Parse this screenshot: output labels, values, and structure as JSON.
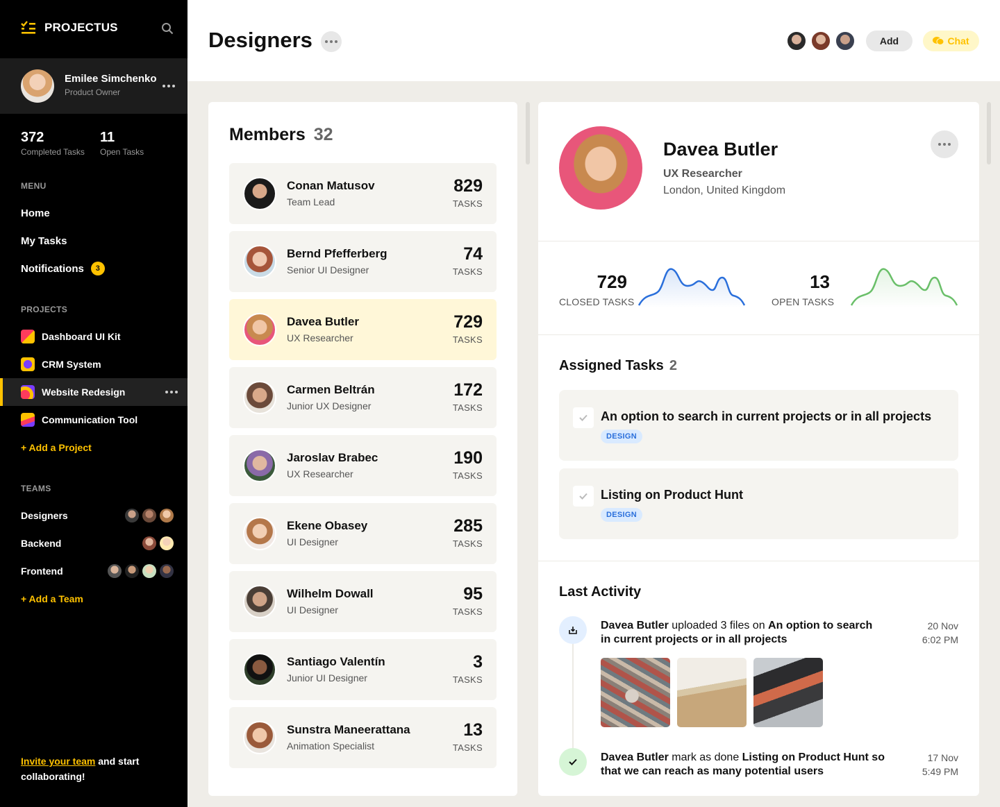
{
  "app": {
    "name": "PROJECTUS"
  },
  "user": {
    "name": "Emilee Simchenko",
    "role": "Product Owner"
  },
  "stats": [
    {
      "value": "372",
      "label": "Completed Tasks"
    },
    {
      "value": "11",
      "label": "Open Tasks"
    }
  ],
  "menu": {
    "heading": "MENU",
    "items": [
      {
        "label": "Home"
      },
      {
        "label": "My Tasks"
      },
      {
        "label": "Notifications",
        "badge": "3"
      }
    ]
  },
  "projects": {
    "heading": "PROJECTS",
    "items": [
      {
        "label": "Dashboard UI Kit"
      },
      {
        "label": "CRM System"
      },
      {
        "label": "Website Redesign",
        "active": true
      },
      {
        "label": "Communication Tool"
      }
    ],
    "add_label": "+ Add a Project"
  },
  "teams": {
    "heading": "TEAMS",
    "items": [
      {
        "label": "Designers"
      },
      {
        "label": "Backend"
      },
      {
        "label": "Frontend"
      }
    ],
    "add_label": "+ Add a Team"
  },
  "invite": {
    "link": "Invite your team",
    "rest": " and start collaborating!"
  },
  "header": {
    "title": "Designers",
    "add_label": "Add",
    "chat_label": "Chat"
  },
  "members": {
    "title": "Members",
    "count": "32",
    "tasks_label": "TASKS",
    "items": [
      {
        "name": "Conan Matusov",
        "role": "Team Lead",
        "tasks": "829"
      },
      {
        "name": "Bernd Pfefferberg",
        "role": "Senior UI Designer",
        "tasks": "74"
      },
      {
        "name": "Davea Butler",
        "role": "UX Researcher",
        "tasks": "729",
        "selected": true
      },
      {
        "name": "Carmen Beltrán",
        "role": "Junior UX Designer",
        "tasks": "172"
      },
      {
        "name": "Jaroslav Brabec",
        "role": "UX Researcher",
        "tasks": "190"
      },
      {
        "name": "Ekene Obasey",
        "role": "UI Designer",
        "tasks": "285"
      },
      {
        "name": "Wilhelm Dowall",
        "role": "UI Designer",
        "tasks": "95"
      },
      {
        "name": "Santiago Valentín",
        "role": "Junior UI Designer",
        "tasks": "3"
      },
      {
        "name": "Sunstra Maneerattana",
        "role": "Animation Specialist",
        "tasks": "13"
      }
    ]
  },
  "detail": {
    "name": "Davea Butler",
    "role": "UX Researcher",
    "location": "London, United Kingdom",
    "closed": {
      "value": "729",
      "label": "CLOSED TASKS",
      "color": "#2a6fdb"
    },
    "open": {
      "value": "13",
      "label": "OPEN TASKS",
      "color": "#6abf69"
    },
    "assigned": {
      "title": "Assigned Tasks",
      "count": "2",
      "items": [
        {
          "title": "An option to search in current projects or in all projects",
          "tag": "DESIGN"
        },
        {
          "title": "Listing on Product Hunt",
          "tag": "DESIGN"
        }
      ]
    },
    "activity": {
      "title": "Last Activity",
      "items": [
        {
          "actor": "Davea Butler",
          "action": " uploaded 3 files on ",
          "target": "An option to search in current projects or in all projects",
          "date": "20 Nov",
          "time": "6:02 PM"
        },
        {
          "actor": "Davea Butler",
          "action": " mark as done ",
          "target": "Listing on Product Hunt so that we can reach as many potential users",
          "date": "17 Nov",
          "time": "5:49 PM"
        }
      ]
    }
  },
  "colors": {
    "accent": "#ffc200",
    "sidebar": "#000000",
    "background": "#efede8"
  }
}
